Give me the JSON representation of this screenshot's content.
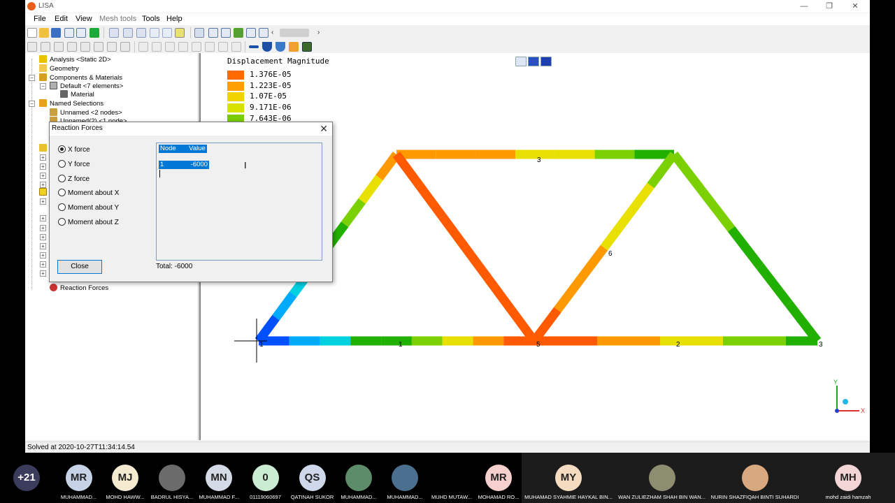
{
  "app": {
    "title": "LISA",
    "minimize": "—",
    "maximize": "❐",
    "close": "✕"
  },
  "menu": {
    "file": "File",
    "edit": "Edit",
    "view": "View",
    "mesh_tools": "Mesh tools",
    "tools": "Tools",
    "help": "Help"
  },
  "tree": {
    "analysis": "Analysis <Static 2D>",
    "geometry": "Geometry",
    "components": "Components & Materials",
    "default": "Default <7 elements>",
    "material": "Material",
    "named_selections": "Named Selections",
    "unnamed": "Unnamed <2 nodes>",
    "unnamed2": "Unnamed(2) <1 node>",
    "reaction_forces": "Reaction Forces"
  },
  "status": {
    "text": "Solved at 2020-10-27T11:34:14.54"
  },
  "legend": {
    "title": "Displacement Magnitude",
    "entries": [
      {
        "label": "1.376E-05",
        "color": "#ff6a00"
      },
      {
        "label": "1.223E-05",
        "color": "#ff9f00"
      },
      {
        "label": "1.07E-05",
        "color": "#f0d400"
      },
      {
        "label": "9.171E-06",
        "color": "#d7e200"
      },
      {
        "label": "7.643E-06",
        "color": "#78cc00"
      }
    ]
  },
  "truss": {
    "node_labels": [
      "1",
      "2",
      "3",
      "5",
      "6"
    ],
    "colors": {
      "blue": "#0050ff",
      "lightblue": "#00aaff",
      "cyan": "#00d0e0",
      "green": "#22b000",
      "lime": "#7ad000",
      "yellow": "#e8e000",
      "orange": "#ff9900",
      "red": "#ff5a00"
    }
  },
  "dialog": {
    "title": "Reaction Forces",
    "close_x": "✕",
    "options": [
      "X force",
      "Y force",
      "Z force",
      "Moment about X",
      "Moment about Y",
      "Moment about Z"
    ],
    "selected_option": "X force",
    "list_header": "Node       Value",
    "row_node": "1",
    "row_value": "-6000",
    "total": "Total: -6000",
    "close_button": "Close"
  },
  "axes": {
    "x": "X",
    "y": "Y"
  },
  "participants": [
    {
      "initials": "+21",
      "name": "",
      "color": "#3b3b5c",
      "text": "#fff"
    },
    {
      "initials": "MR",
      "name": "MUHAMMAD...",
      "color": "#c6d3e6",
      "text": "#222"
    },
    {
      "initials": "MJ",
      "name": "MOHD HAWW...",
      "color": "#f3ead0",
      "text": "#222"
    },
    {
      "initials": "",
      "name": "BADRUL HISYA...",
      "color": "#6b6b6b",
      "text": "#222"
    },
    {
      "initials": "MN",
      "name": "MUHAMMAD F...",
      "color": "#d4dbe6",
      "text": "#222"
    },
    {
      "initials": "0",
      "name": "01119060697",
      "color": "#c9ecd2",
      "text": "#222"
    },
    {
      "initials": "QS",
      "name": "QATINAH SUKOR",
      "color": "#cfd8ea",
      "text": "#222"
    },
    {
      "initials": "",
      "name": "MUHAMMAD...",
      "color": "#5d8c6a",
      "text": "#222"
    },
    {
      "initials": "",
      "name": "MUHAMMAD...",
      "color": "#4a6f8f",
      "text": "#222"
    },
    {
      "initials": "",
      "name": "MUHD MUTAW...",
      "color": "#000000",
      "text": "#222"
    },
    {
      "initials": "MR",
      "name": "MOHAMAD RO...",
      "color": "#f5d0cc",
      "text": "#222"
    },
    {
      "initials": "MY",
      "name": "MUHAMAD SYAHMIE HAYKAL BIN...",
      "color": "#f5dcc0",
      "text": "#222"
    },
    {
      "initials": "",
      "name": "WAN ZULIEZHAM SHAH BIN WAN...",
      "color": "#8d8d70",
      "text": "#222"
    },
    {
      "initials": "",
      "name": "NURIN SHAZFIQAH BINTI SUHARDI",
      "color": "#d8a880",
      "text": "#222"
    },
    {
      "initials": "MH",
      "name": "mohd zaidi hamzah",
      "color": "#f3d5d5",
      "text": "#222"
    }
  ]
}
